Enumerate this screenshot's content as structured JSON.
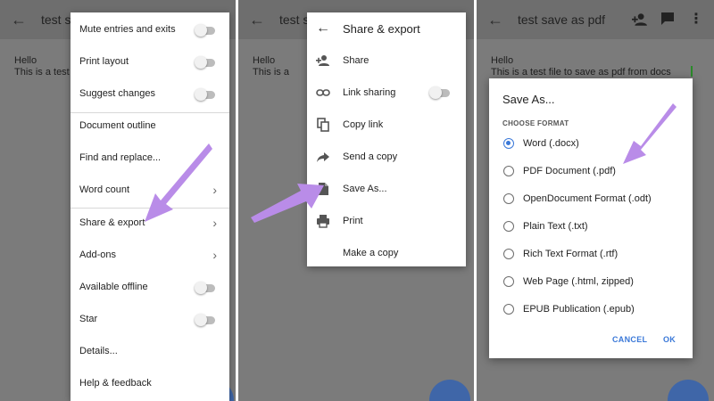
{
  "colors": {
    "overlay": "#7b7b7b",
    "accent_blue": "#3a78d8",
    "arrow_purple": "#b98ce8",
    "fab_blue": "#3f66a8"
  },
  "panel1": {
    "title": "test s",
    "doc": {
      "line1": "Hello",
      "line2": "This is a test fil"
    },
    "menu": [
      {
        "label": "Mute entries and exits",
        "trailing": "toggle"
      },
      {
        "label": "Print layout",
        "trailing": "toggle"
      },
      {
        "label": "Suggest changes",
        "trailing": "toggle"
      },
      {
        "label": "Document outline",
        "trailing": "none"
      },
      {
        "label": "Find and replace...",
        "trailing": "none"
      },
      {
        "label": "Word count",
        "trailing": "chevron"
      },
      {
        "label": "Share & export",
        "trailing": "chevron"
      },
      {
        "label": "Add-ons",
        "trailing": "chevron"
      },
      {
        "label": "Available offline",
        "trailing": "toggle"
      },
      {
        "label": "Star",
        "trailing": "toggle"
      },
      {
        "label": "Details...",
        "trailing": "none"
      },
      {
        "label": "Help & feedback",
        "trailing": "none"
      }
    ]
  },
  "panel2": {
    "title": "test sa",
    "doc": {
      "line1": "Hello",
      "line2": "This is a"
    },
    "menu_title": "Share & export",
    "menu": [
      {
        "label": "Share",
        "icon": "add-person-icon"
      },
      {
        "label": "Link sharing",
        "icon": "link-icon",
        "trailing": "toggle"
      },
      {
        "label": "Copy link",
        "icon": "copy-icon"
      },
      {
        "label": "Send a copy",
        "icon": "forward-arrow-icon"
      },
      {
        "label": "Save As...",
        "icon": "file-icon"
      },
      {
        "label": "Print",
        "icon": "printer-icon"
      },
      {
        "label": "Make a copy",
        "icon": "none"
      }
    ]
  },
  "panel3": {
    "title": "test save as pdf",
    "doc": {
      "line1": "Hello",
      "line2": "This is a test file to save as pdf from docs"
    },
    "dialog": {
      "title": "Save As...",
      "subtitle": "CHOOSE FORMAT",
      "options": [
        {
          "label": "Word (.docx)",
          "selected": true
        },
        {
          "label": "PDF Document (.pdf)",
          "selected": false
        },
        {
          "label": "OpenDocument Format (.odt)",
          "selected": false
        },
        {
          "label": "Plain Text (.txt)",
          "selected": false
        },
        {
          "label": "Rich Text Format (.rtf)",
          "selected": false
        },
        {
          "label": "Web Page (.html, zipped)",
          "selected": false
        },
        {
          "label": "EPUB Publication (.epub)",
          "selected": false
        }
      ],
      "cancel": "CANCEL",
      "ok": "OK"
    }
  }
}
